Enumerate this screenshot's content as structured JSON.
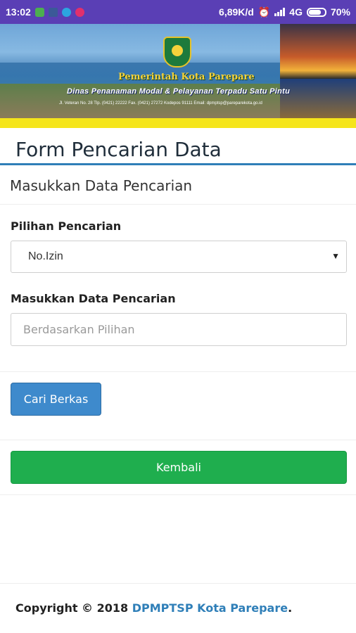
{
  "status_bar": {
    "time": "13:02",
    "network_speed": "6,89K/d",
    "network_type": "4G",
    "battery": "70%",
    "icons": [
      "message-icon",
      "facebook-icon",
      "telegram-icon",
      "instagram-icon",
      "alarm-icon",
      "signal-icon",
      "battery-icon"
    ]
  },
  "banner": {
    "title": "Pemerintah Kota Parepare",
    "subtitle": "Dinas Penanaman Modal & Pelayanan Terpadu Satu Pintu",
    "address": "Jl. Veteran No. 28 Tlp. (0421) 22222 Fax. (0421) 27272 Kodepos 91111 Email: dpmptsp@pareparekota.go.id"
  },
  "header": {
    "title": "Form Pencarian Data"
  },
  "panel": {
    "heading": "Masukkan Data Pencarian"
  },
  "form": {
    "select_label": "Pilihan Pencarian",
    "select_value": "No.Izin",
    "input_label": "Masukkan Data Pencarian",
    "input_placeholder": "Berdasarkan Pilihan",
    "search_button": "Cari Berkas",
    "back_button": "Kembali"
  },
  "footer": {
    "prefix": "Copyright © 2018 ",
    "link": "DPMPTSP Kota Parepare",
    "suffix": "."
  },
  "colors": {
    "status_bar": "#5a3fb5",
    "accent_blue": "#3e8acc",
    "success_green": "#1fae4e",
    "banner_yellow": "#f5e51b",
    "link": "#2f7fb8"
  }
}
